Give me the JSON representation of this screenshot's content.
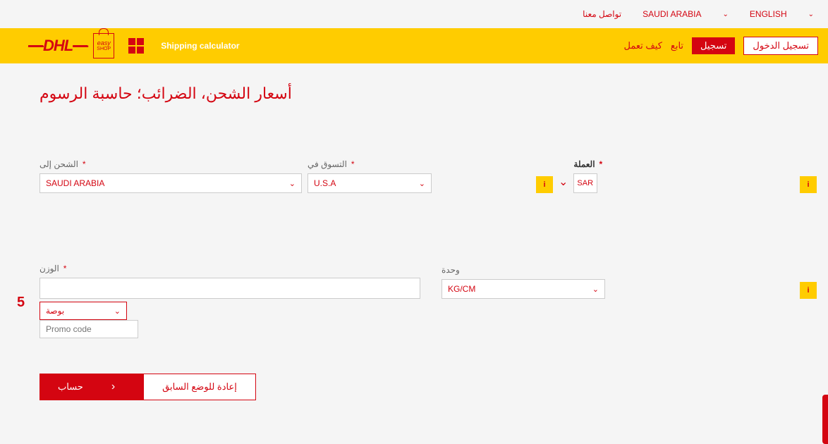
{
  "topbar": {
    "contact": "تواصل معنا",
    "country": "SAUDI ARABIA",
    "language": "ENGLISH"
  },
  "header": {
    "logo_text": "DHL",
    "easy": "easy",
    "shop": "SHOP",
    "calc_label": "Shipping calculator"
  },
  "nav": {
    "how_works": "كيف تعمل",
    "track": "تابع",
    "register": "تسجيل",
    "login": "تسجيل الدخول"
  },
  "page": {
    "title": "أسعار الشحن، الضرائب؛ حاسبة الرسوم"
  },
  "form": {
    "ship_to_label": "الشحن إلى",
    "ship_to_value": "SAUDI ARABIA",
    "shop_in_label": "التسوق في",
    "shop_in_value": "U.S.A",
    "currency_label": "العملة",
    "currency_value": "SAR",
    "weight_label": "الوزن",
    "weight_value": "",
    "unit_label": "وحدة",
    "unit_value": "KG/CM",
    "dimension_value": "بوصة",
    "promo_placeholder": "Promo code",
    "step": "5",
    "info": "i"
  },
  "buttons": {
    "calculate": "حساب",
    "reset": "إعادة للوضع السابق"
  }
}
